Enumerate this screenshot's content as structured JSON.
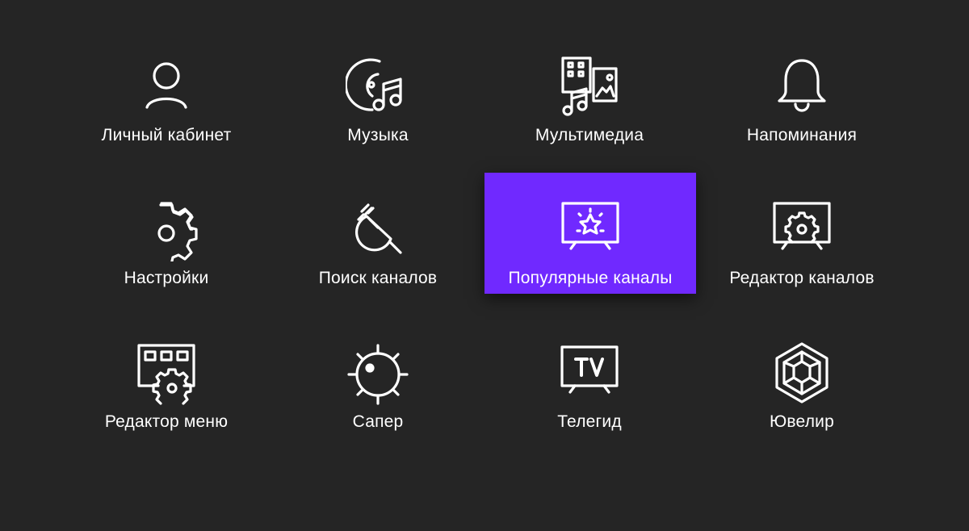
{
  "menu": {
    "items": [
      {
        "label": "Личный кабинет",
        "icon": "user-icon"
      },
      {
        "label": "Музыка",
        "icon": "music-icon"
      },
      {
        "label": "Мультимедиа",
        "icon": "multimedia-icon"
      },
      {
        "label": "Напоминания",
        "icon": "bell-icon"
      },
      {
        "label": "Настройки",
        "icon": "gear-icon"
      },
      {
        "label": "Поиск каналов",
        "icon": "satellite-search-icon"
      },
      {
        "label": "Популярные каналы",
        "icon": "tv-star-icon",
        "selected": true
      },
      {
        "label": "Редактор каналов",
        "icon": "tv-gear-icon"
      },
      {
        "label": "Редактор меню",
        "icon": "menu-editor-icon"
      },
      {
        "label": "Сапер",
        "icon": "mine-icon"
      },
      {
        "label": "Телегид",
        "icon": "tv-guide-icon"
      },
      {
        "label": "Ювелир",
        "icon": "gem-icon"
      }
    ]
  },
  "colors": {
    "background": "#252525",
    "selected": "#7029ff",
    "foreground": "#ffffff"
  }
}
